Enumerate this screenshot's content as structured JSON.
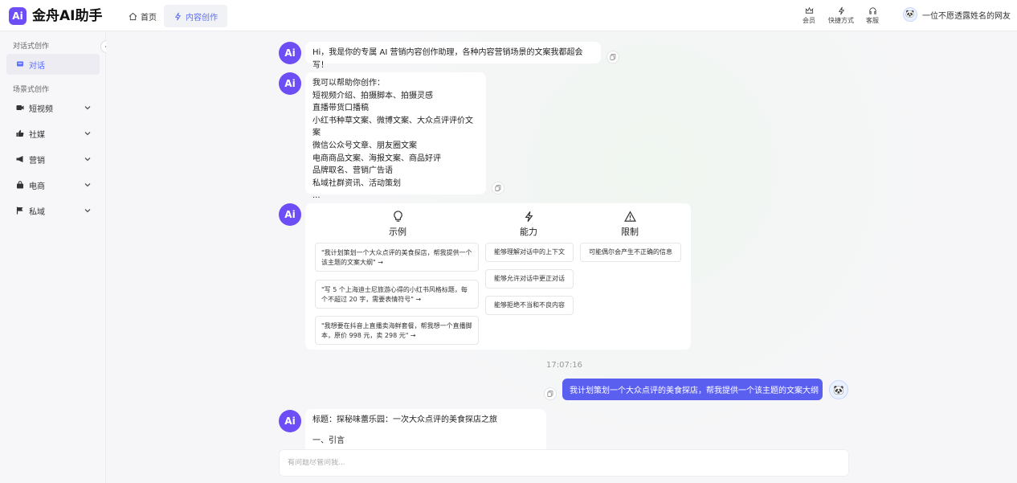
{
  "header": {
    "logo_badge": "Ai",
    "app_name": "金舟AI助手",
    "nav": [
      {
        "label": "首页"
      },
      {
        "label": "内容创作"
      }
    ],
    "tools": [
      {
        "label": "会员",
        "icon": "crown-icon"
      },
      {
        "label": "快捷方式",
        "icon": "lightning-icon"
      },
      {
        "label": "客服",
        "icon": "headset-icon"
      }
    ],
    "user_name": "一位不愿透露姓名的网友"
  },
  "sidebar": {
    "section_chat": "对话式创作",
    "chat_item": "对话",
    "section_scene": "场景式创作",
    "scene_items": [
      {
        "label": "短视频",
        "icon": "video-icon"
      },
      {
        "label": "社媒",
        "icon": "thumbs-up-icon"
      },
      {
        "label": "营销",
        "icon": "megaphone-icon"
      },
      {
        "label": "电商",
        "icon": "shopping-bag-icon"
      },
      {
        "label": "私域",
        "icon": "flag-icon"
      }
    ]
  },
  "chat": {
    "greeting": "Hi，我是你的专属 AI 营销内容创作助理，各种内容营销场景的文案我都超会写！",
    "capabilities_intro": "我可以帮助你创作：",
    "capabilities": [
      "短视频介绍、拍摄脚本、拍摄灵感",
      "直播带货口播稿",
      "小红书种草文案、微博文案、大众点评评价文案",
      "微信公众号文章、朋友圈文案",
      "电商商品文案、海报文案、商品好评",
      "品牌取名、营销广告语",
      "私域社群资讯、活动策划",
      "..."
    ],
    "info": {
      "examples_title": "示例",
      "examples": [
        "\"我计划策划一个大众点评的美食探店，帮我提供一个该主题的文案大纲\" →",
        "\"写 5 个上海迪士尼旅游心得的小红书风格标题，每个不超过 20 字，需要表情符号\" →",
        "\"我想要在抖音上直播卖海鲜套餐，帮我想一个直播脚本，原价 998 元，卖 298 元\" →"
      ],
      "abilities_title": "能力",
      "abilities": [
        "能够理解对话中的上下文",
        "能够允许对话中更正对话",
        "能够拒绝不当和不良内容"
      ],
      "limits_title": "限制",
      "limits": [
        "可能偶尔会产生不正确的信息"
      ]
    },
    "timestamp": "17:07:16",
    "user_message": "我计划策划一个大众点评的美食探店，帮我提供一个该主题的文案大纲",
    "reply_title": "标题：探秘味蕾乐园：一次大众点评的美食探店之旅",
    "reply_section": "一、引言"
  },
  "input": {
    "placeholder": "有问题尽管问我..."
  },
  "colors": {
    "brand": "#6c4df6",
    "accent": "#5b6dff",
    "user_bubble": "#5b5ff0"
  }
}
